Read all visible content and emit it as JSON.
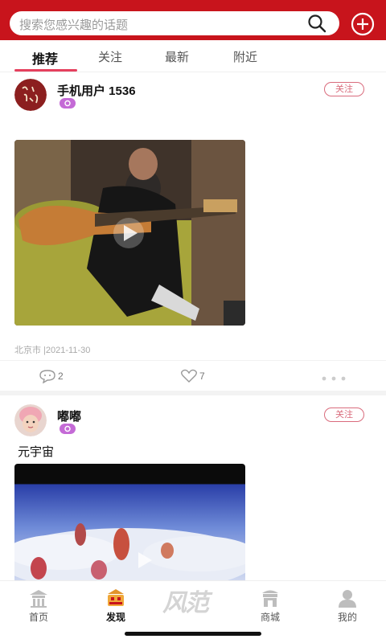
{
  "search": {
    "placeholder": "搜索您感兴趣的话题"
  },
  "tabs": [
    {
      "label": "推荐",
      "active": true
    },
    {
      "label": "关注",
      "active": false
    },
    {
      "label": "最新",
      "active": false
    },
    {
      "label": "附近",
      "active": false
    }
  ],
  "posts": [
    {
      "username": "手机用户 1536",
      "follow_label": "关注",
      "caption": "",
      "location_date": "北京市 |2021-11-30",
      "comments": "2",
      "likes": "7"
    },
    {
      "username": "嘟嘟",
      "follow_label": "关注",
      "caption": "元宇宙"
    }
  ],
  "bottom_nav": [
    {
      "label": "首页",
      "icon": "temple-icon",
      "active": false
    },
    {
      "label": "发现",
      "icon": "discover-icon",
      "active": true
    },
    {
      "logo": "风范"
    },
    {
      "label": "商城",
      "icon": "store-icon",
      "active": false
    },
    {
      "label": "我的",
      "icon": "profile-icon",
      "active": false
    }
  ],
  "colors": {
    "header_red": "#c8141c",
    "accent_pink": "#e5405e",
    "follow_pink": "#d96b7c",
    "badge_purple": "#c46ad6"
  }
}
